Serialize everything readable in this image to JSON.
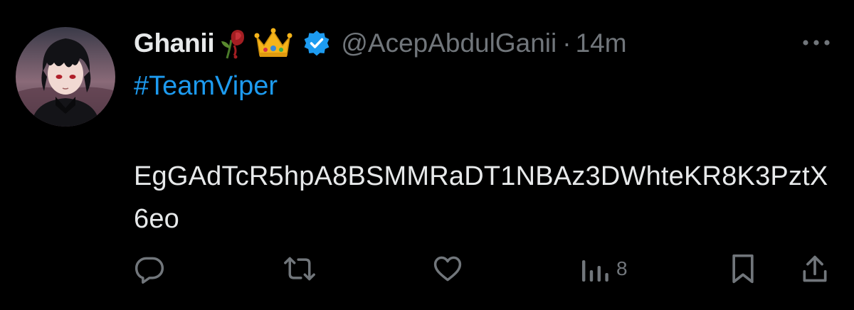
{
  "tweet": {
    "display_name": "Ghanii",
    "name_emojis": [
      "wilted-flower-emoji",
      "crown-emoji"
    ],
    "verified": true,
    "handle": "@AcepAbdulGanii",
    "separator": "·",
    "time": "14m",
    "hashtag": "#TeamViper",
    "body": "EgGAdTcR5hpA8BSMMRaDT1NBAz3DWhteKR8K3PztX6eo"
  },
  "actions": {
    "reply_icon": "reply-icon",
    "retweet_icon": "retweet-icon",
    "like_icon": "heart-icon",
    "views_icon": "views-icon",
    "views_count": "8",
    "bookmark_icon": "bookmark-icon",
    "share_icon": "share-icon"
  },
  "colors": {
    "background": "#000000",
    "text": "#e7e9ea",
    "muted": "#71767b",
    "accent": "#1d9bf0"
  }
}
